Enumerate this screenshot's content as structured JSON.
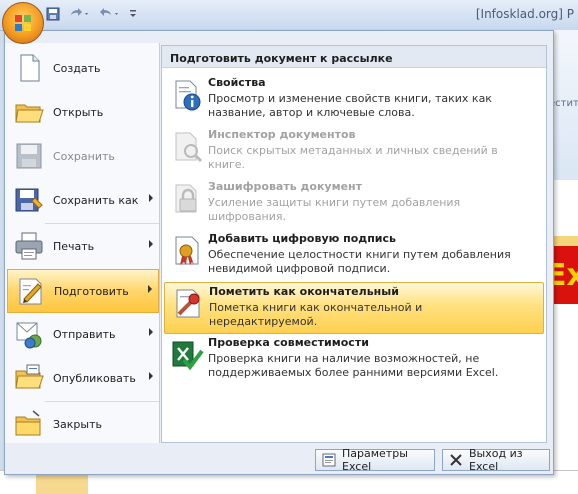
{
  "window": {
    "title": "[Infosklad.org] P"
  },
  "qat": {
    "items": [
      "save-icon",
      "undo-icon",
      "redo-icon",
      "customize-icon"
    ]
  },
  "background": {
    "ribbon_tab": "естит",
    "sheet_text": "Exc"
  },
  "menu": {
    "left": [
      {
        "id": "create",
        "label": "Создать",
        "icon": "new-document-icon",
        "disabled": false,
        "arrow": false
      },
      {
        "id": "open",
        "label": "Открыть",
        "icon": "open-folder-icon",
        "disabled": false,
        "arrow": false
      },
      {
        "id": "save",
        "label": "Сохранить",
        "icon": "save-disk-icon",
        "disabled": true,
        "arrow": false
      },
      {
        "id": "save-as",
        "label": "Сохранить как",
        "icon": "save-as-icon",
        "disabled": false,
        "arrow": true
      },
      {
        "id": "print",
        "label": "Печать",
        "icon": "printer-icon",
        "disabled": false,
        "arrow": true
      },
      {
        "id": "prepare",
        "label": "Подготовить",
        "icon": "prepare-icon",
        "disabled": false,
        "arrow": true,
        "active": true
      },
      {
        "id": "send",
        "label": "Отправить",
        "icon": "send-icon",
        "disabled": false,
        "arrow": true
      },
      {
        "id": "publish",
        "label": "Опубликовать",
        "icon": "publish-icon",
        "disabled": false,
        "arrow": true
      },
      {
        "id": "close",
        "label": "Закрыть",
        "icon": "close-folder-icon",
        "disabled": false,
        "arrow": false
      }
    ],
    "submenu": {
      "header": "Подготовить документ к рассылке",
      "items": [
        {
          "title": "Свойства",
          "desc": "Просмотр и изменение свойств книги, таких как название, автор и ключевые слова.",
          "icon": "properties-icon",
          "disabled": false
        },
        {
          "title": "Инспектор документов",
          "desc": "Поиск скрытых метаданных и личных сведений в книге.",
          "icon": "inspect-document-icon",
          "disabled": true
        },
        {
          "title": "Зашифровать документ",
          "desc": "Усиление защиты книги путем добавления шифрования.",
          "icon": "encrypt-lock-icon",
          "disabled": true
        },
        {
          "title": "Добавить цифровую подпись",
          "desc": "Обеспечение целостности книги путем добавления невидимой цифровой подписи.",
          "icon": "digital-signature-icon",
          "disabled": false
        },
        {
          "title": "Пометить как окончательный",
          "desc": "Пометка книги как окончательной и нередактируемой.",
          "icon": "mark-final-icon",
          "disabled": false,
          "active": true
        },
        {
          "title": "Проверка совместимости",
          "desc": "Проверка книги на наличие возможностей, не поддерживаемых более ранними версиями Excel.",
          "icon": "compatibility-check-icon",
          "disabled": false
        }
      ]
    },
    "buttons": {
      "options": "Параметры Excel",
      "exit": "Выход из Excel"
    }
  }
}
